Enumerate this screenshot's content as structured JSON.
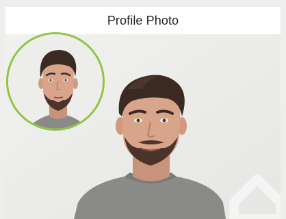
{
  "header": {
    "title": "Profile Photo"
  },
  "photo": {
    "subject": "portrait-photo",
    "preview_subject": "face-preview",
    "watermark": "watermark-icon"
  },
  "colors": {
    "background": "#eeeeec",
    "header_bg": "#ffffff",
    "preview_ring": "#8cc63f",
    "shirt": "#8a8a88",
    "hair": "#3a2a22",
    "skin": "#d8a48a"
  }
}
